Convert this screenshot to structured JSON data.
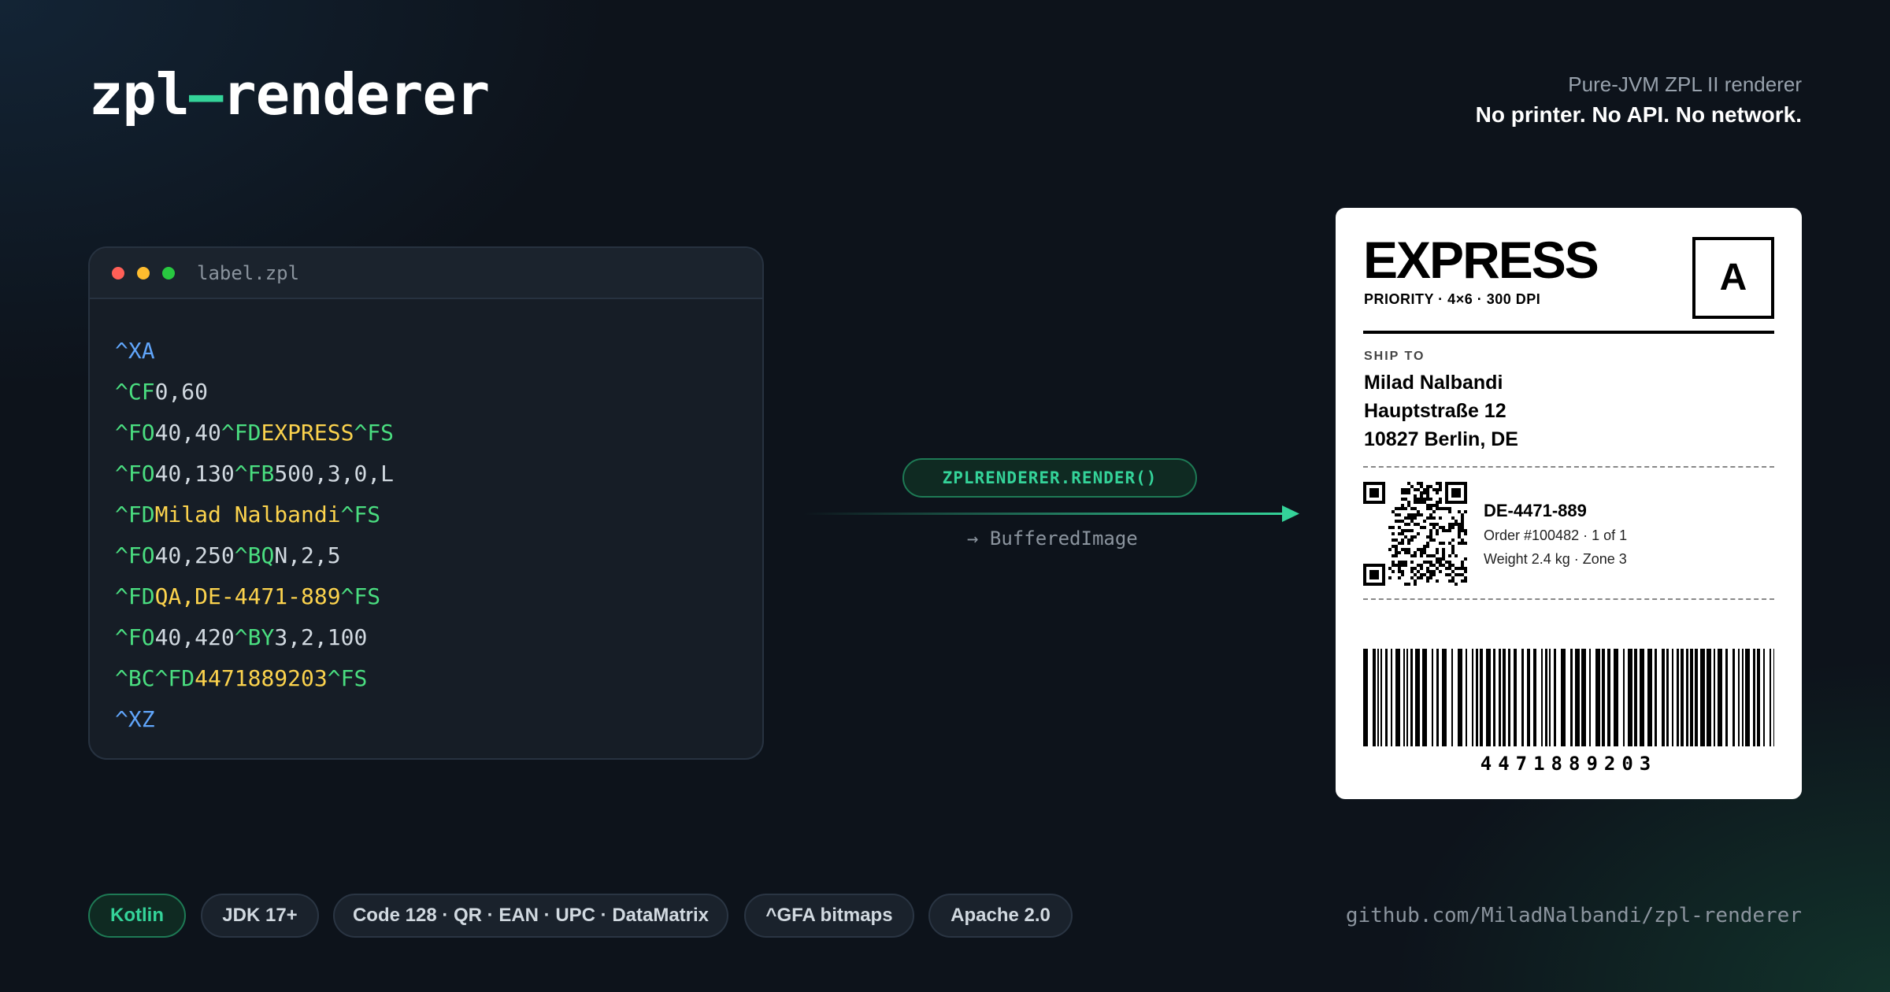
{
  "header": {
    "title_left": "zpl",
    "title_dash": "—",
    "title_right": "renderer",
    "tagline_1": "Pure-JVM ZPL II renderer",
    "tagline_2": "No printer. No API. No network."
  },
  "code": {
    "file_name": "label.zpl",
    "lines": [
      [
        {
          "t": "^XA",
          "c": "kw"
        }
      ],
      [
        {
          "t": "^CF",
          "c": "cmd"
        },
        {
          "t": "0,60",
          "c": "txt"
        }
      ],
      [
        {
          "t": "^FO",
          "c": "cmd"
        },
        {
          "t": "40,40",
          "c": "txt"
        },
        {
          "t": "^FD",
          "c": "cmd"
        },
        {
          "t": "EXPRESS",
          "c": "val"
        },
        {
          "t": "^FS",
          "c": "cmd"
        }
      ],
      [
        {
          "t": "^FO",
          "c": "cmd"
        },
        {
          "t": "40,130",
          "c": "txt"
        },
        {
          "t": "^FB",
          "c": "cmd"
        },
        {
          "t": "500,3,0,L",
          "c": "txt"
        }
      ],
      [
        {
          "t": "^FD",
          "c": "cmd"
        },
        {
          "t": "Milad Nalbandi",
          "c": "val"
        },
        {
          "t": "^FS",
          "c": "cmd"
        }
      ],
      [
        {
          "t": "^FO",
          "c": "cmd"
        },
        {
          "t": "40,250",
          "c": "txt"
        },
        {
          "t": "^BQ",
          "c": "cmd"
        },
        {
          "t": "N,2,5",
          "c": "txt"
        }
      ],
      [
        {
          "t": "^FD",
          "c": "cmd"
        },
        {
          "t": "QA,DE-4471-889",
          "c": "val"
        },
        {
          "t": "^FS",
          "c": "cmd"
        }
      ],
      [
        {
          "t": "^FO",
          "c": "cmd"
        },
        {
          "t": "40,420",
          "c": "txt"
        },
        {
          "t": "^BY",
          "c": "cmd"
        },
        {
          "t": "3,2,100",
          "c": "txt"
        }
      ],
      [
        {
          "t": "^BC",
          "c": "cmd"
        },
        {
          "t": "^FD",
          "c": "cmd"
        },
        {
          "t": "4471889203",
          "c": "val"
        },
        {
          "t": "^FS",
          "c": "cmd"
        }
      ],
      [
        {
          "t": "^XZ",
          "c": "kw"
        }
      ]
    ]
  },
  "render_call": "ZPLRENDERER.RENDER()",
  "return_type": "→ BufferedImage",
  "label": {
    "service": "EXPRESS",
    "meta": "PRIORITY · 4×6 · 300 DPI",
    "zone_letter": "A",
    "ship_to_label": "SHIP TO",
    "name": "Milad Nalbandi",
    "street": "Hauptstraße 12",
    "city": "10827 Berlin, DE",
    "tracking": "DE-4471-889",
    "order": "Order #100482 · 1 of 1",
    "weight": "Weight 2.4 kg · Zone 3",
    "barcode_number": "4471889203"
  },
  "chips": {
    "kotlin": "Kotlin",
    "jdk": "JDK 17+",
    "formats": "Code 128 · QR · EAN · UPC · DataMatrix",
    "gfa": "^GFA bitmaps",
    "license": "Apache 2.0"
  },
  "repo_link": "github.com/MiladNalbandi/zpl-renderer",
  "colors": {
    "accent": "#34d399",
    "background": "#0d131b",
    "code_cmd": "#4ade80",
    "code_kw": "#60a5fa",
    "code_val": "#fcd34d"
  }
}
